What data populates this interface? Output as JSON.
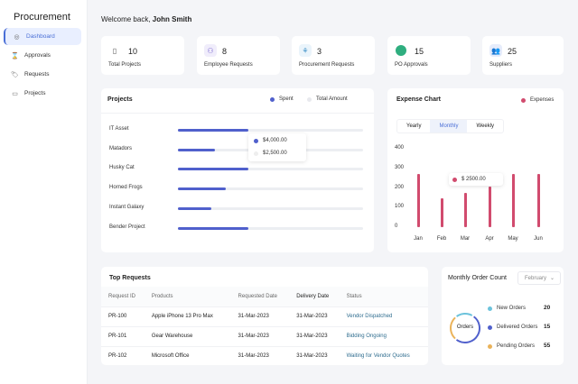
{
  "sidebar": {
    "title": "Procurement",
    "items": [
      {
        "label": "Dashboard",
        "icon": "dashboard-icon",
        "active": true
      },
      {
        "label": "Approvals",
        "icon": "hourglass-icon"
      },
      {
        "label": "Requests",
        "icon": "tag-icon"
      },
      {
        "label": "Projects",
        "icon": "folder-icon"
      }
    ]
  },
  "header": {
    "greeting": "Welcome back,",
    "user": "John Smith"
  },
  "stats": [
    {
      "value": "10",
      "label": "Total Projects",
      "icon": "document-icon"
    },
    {
      "value": "8",
      "label": "Employee Requests",
      "icon": "employee-icon"
    },
    {
      "value": "3",
      "label": "Procurement Requests",
      "icon": "procurement-icon"
    },
    {
      "value": "15",
      "label": "PO Approvals",
      "icon": "circle-icon",
      "color": "#2fae7f"
    },
    {
      "value": "25",
      "label": "Suppliers",
      "icon": "users-icon"
    }
  ],
  "projects": {
    "title": "Projects",
    "legend": [
      "Spent",
      "Total Amount"
    ],
    "colors": {
      "spent": "#5060cc",
      "total": "#eceef2"
    },
    "items": [
      {
        "name": "IT Asset",
        "spent_pct": 38
      },
      {
        "name": "Matadors",
        "spent_pct": 20
      },
      {
        "name": "Husky Cat",
        "spent_pct": 38
      },
      {
        "name": "Horned Frogs",
        "spent_pct": 26
      },
      {
        "name": "Instant Galaxy",
        "spent_pct": 18
      },
      {
        "name": "Bender Project",
        "spent_pct": 38
      }
    ],
    "tooltip": {
      "spent": "$4,000.00",
      "total": "$2,500.00"
    }
  },
  "expense": {
    "title": "Expense Chart",
    "tabs": [
      "Yearly",
      "Monthly",
      "Weekly"
    ],
    "active_tab": "Monthly",
    "tooltip": "$ 2500.00",
    "chart_data": {
      "type": "bar",
      "categories": [
        "Jan",
        "Feb",
        "Mar",
        "Apr",
        "May",
        "Jun"
      ],
      "series": [
        {
          "name": "Expenses",
          "values": [
            270,
            145,
            175,
            205,
            270,
            270
          ]
        }
      ],
      "yticks": [
        "0",
        "100",
        "200",
        "300",
        "400"
      ],
      "ylim": [
        0,
        400
      ],
      "color": "#d14b6e",
      "grid": false,
      "legend": "top-right"
    }
  },
  "requests": {
    "title": "Top Requests",
    "columns": [
      "Request ID",
      "Products",
      "Requested Date",
      "Delivery Date",
      "Status"
    ],
    "rows": [
      [
        "PR-100",
        "Apple iPhone 13 Pro Max",
        "31-Mar-2023",
        "31-Mar-2023",
        "Vendor Dispatched"
      ],
      [
        "PR-101",
        "Gear Warehouse",
        "31-Mar-2023",
        "31-Mar-2023",
        "Bidding Ongoing"
      ],
      [
        "PR-102",
        "Microsoft Office",
        "31-Mar-2023",
        "31-Mar-2023",
        "Waiting for Vendor Quotes"
      ]
    ]
  },
  "orders": {
    "title": "Monthly Order Count",
    "month": "February",
    "center": "Orders",
    "items": [
      {
        "label": "New Orders",
        "value": "20",
        "color": "#6cc3dc"
      },
      {
        "label": "Delivered Orders",
        "value": "15",
        "color": "#5060cc"
      },
      {
        "label": "Pending Orders",
        "value": "55",
        "color": "#eab35a"
      }
    ]
  }
}
